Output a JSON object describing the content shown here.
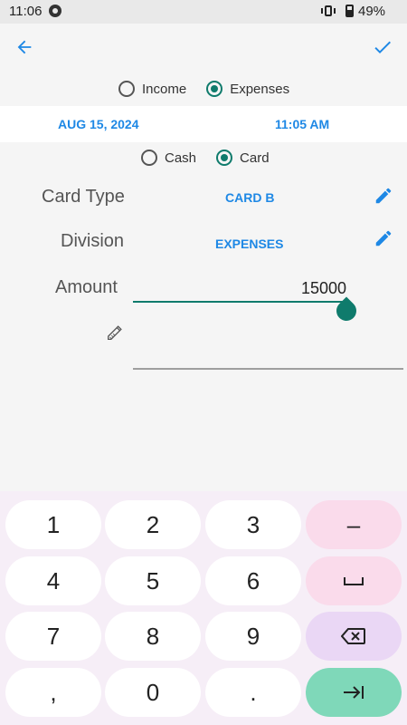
{
  "status_bar": {
    "time": "11:06",
    "battery": "49%"
  },
  "toolbar": {
    "back_icon": "arrow-left-icon",
    "confirm_icon": "check-icon",
    "accent": "#1e88e5"
  },
  "type_radio": {
    "options": [
      "Income",
      "Expenses"
    ],
    "selected": "Expenses"
  },
  "date_time": {
    "date": "AUG 15, 2024",
    "time": "11:05 AM"
  },
  "payment_radio": {
    "options": [
      "Cash",
      "Card"
    ],
    "selected": "Card"
  },
  "form": {
    "card_type_label": "Card Type",
    "card_type_value": "CARD B",
    "division_label": "Division",
    "division_value": "EXPENSES",
    "amount_label": "Amount",
    "amount_value": "15000",
    "memo_icon": "pencil-icon",
    "edit_icon": "edit-pencil-icon",
    "memo_value": ""
  },
  "keypad": {
    "rows": [
      [
        "1",
        "2",
        "3",
        "–"
      ],
      [
        "4",
        "5",
        "6",
        "␣"
      ],
      [
        "7",
        "8",
        "9",
        "⌫"
      ],
      [
        ",",
        "0",
        ".",
        "⇥"
      ]
    ]
  },
  "colors": {
    "accent_blue": "#1e88e5",
    "teal": "#0f7b6c",
    "key_pink": "#fadbeb",
    "key_purple": "#ead7f5",
    "key_green": "#7fd8b9"
  }
}
